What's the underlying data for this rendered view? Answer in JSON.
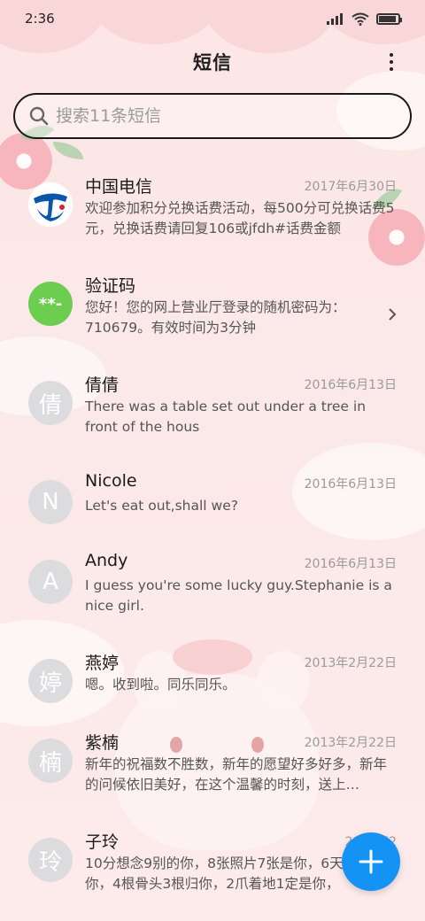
{
  "status": {
    "time": "2:36",
    "battery_level": 0.9
  },
  "header": {
    "title": "短信"
  },
  "search": {
    "placeholder": "搜索11条短信"
  },
  "conversations": [
    {
      "name": "中国电信",
      "date": "2017年6月30日",
      "preview": "欢迎参加积分兑换话费活动，每500分可兑换话费5元，兑换话费请回复106或jfdh#话费金额",
      "avatar": "china-telecom-logo"
    },
    {
      "name": "验证码",
      "date": "",
      "preview": "您好！您的网上营业厅登录的随机密码为：710679。有效时间为3分钟",
      "avatar": "**-"
    },
    {
      "name": "倩倩",
      "date": "2016年6月13日",
      "preview": "There was a table set out under a tree in front of the hous",
      "avatar": "倩"
    },
    {
      "name": "Nicole",
      "date": "2016年6月13日",
      "preview": "Let's eat out,shall we?",
      "avatar": "N"
    },
    {
      "name": "Andy",
      "date": "2016年6月13日",
      "preview": "I guess you're some lucky guy.Stephanie is a nice girl.",
      "avatar": "A"
    },
    {
      "name": "燕婷",
      "date": "2013年2月22日",
      "preview": "嗯。收到啦。同乐同乐。",
      "avatar": "婷"
    },
    {
      "name": "紫楠",
      "date": "2013年2月22日",
      "preview": "新年的祝福数不胜数，新年的愿望好多好多，新年的问候依旧美好，在这个温馨的时刻，送上…",
      "avatar": "楠"
    },
    {
      "name": "子玲",
      "date": "2013年2",
      "preview": "10分想念9别的你，8张照片7张是你，6天只像你，4根骨头3根归你，2爪着地1定是你，",
      "avatar": "玲"
    }
  ],
  "colors": {
    "accent": "#1593f5",
    "verify_avatar": "#6ccd4e",
    "telecom_blue": "#0a57a8"
  }
}
